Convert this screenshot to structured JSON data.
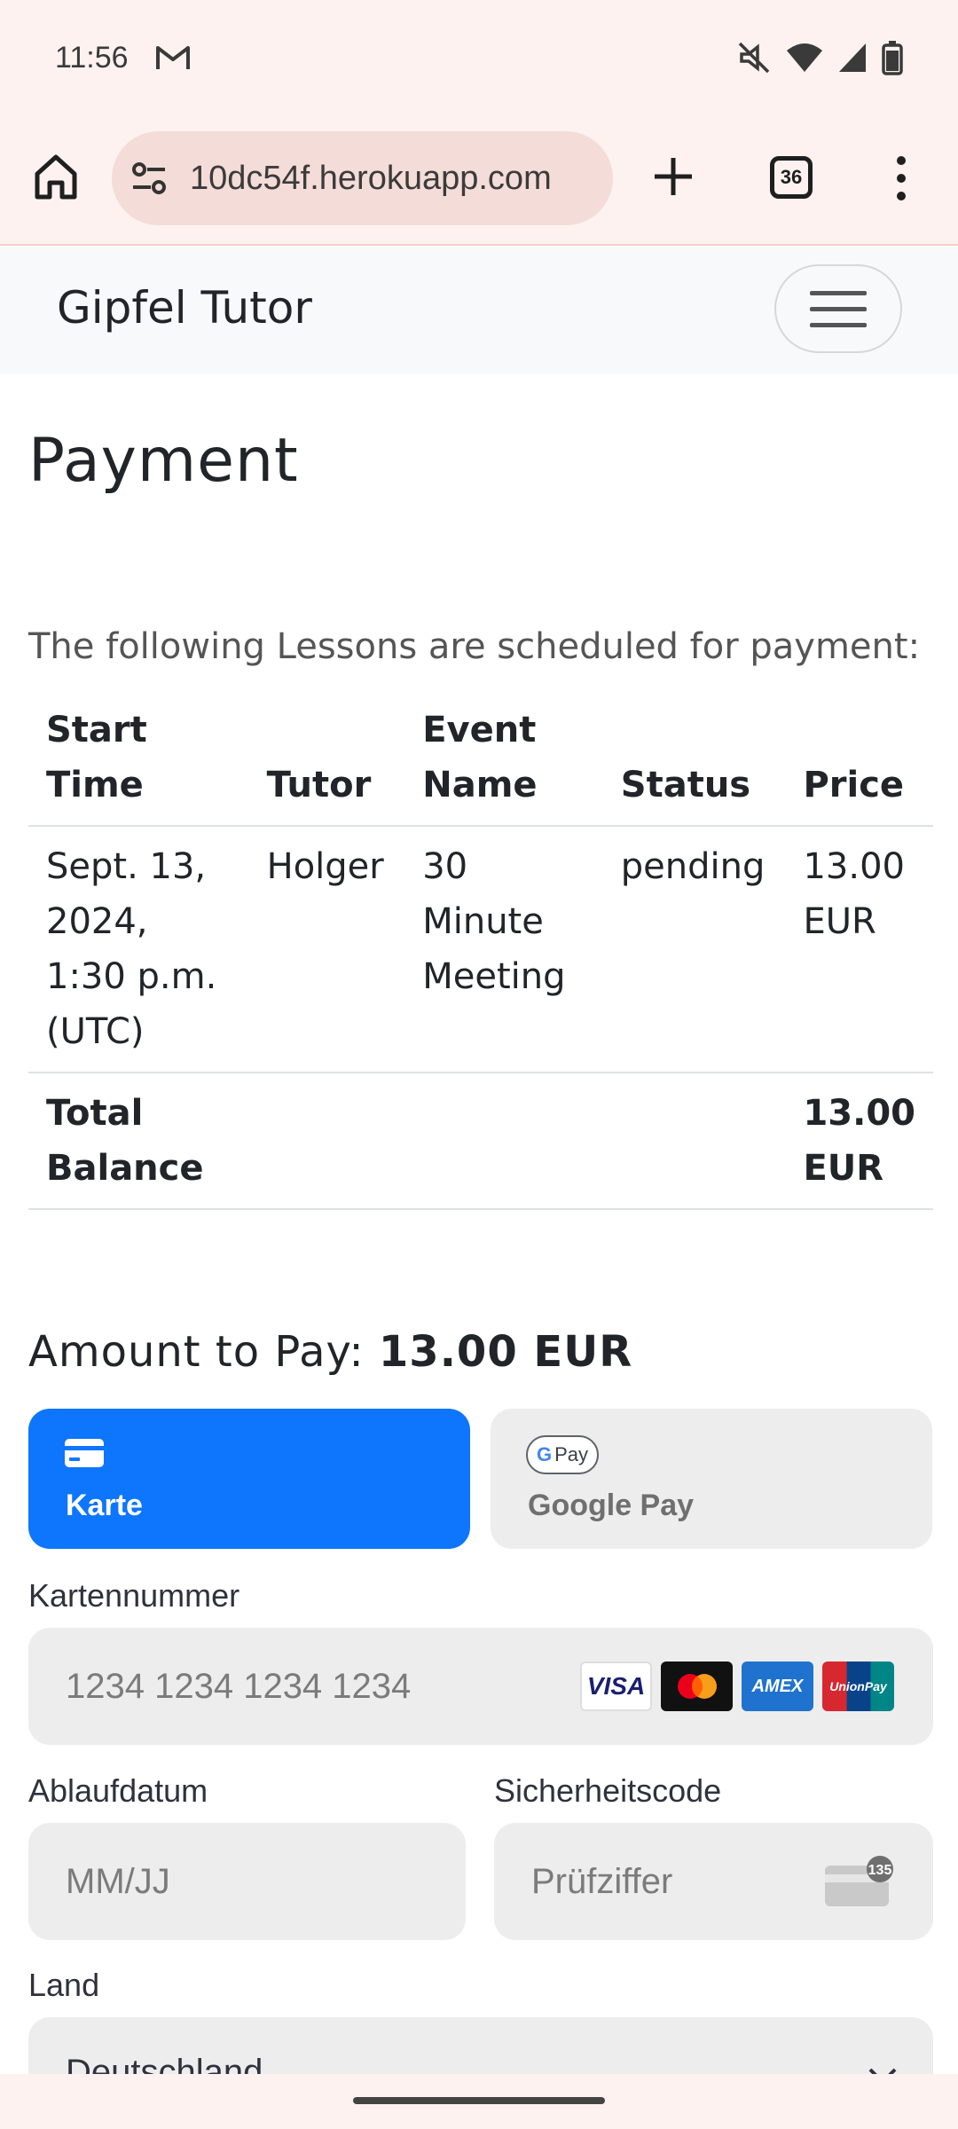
{
  "status_bar": {
    "time": "11:56",
    "icons": [
      "gmail-icon",
      "mute-icon",
      "wifi-icon",
      "signal-icon",
      "battery-icon"
    ]
  },
  "browser": {
    "url": "10dc54f.herokuapp.com",
    "tab_count": "36",
    "icons": [
      "home-icon",
      "site-settings-icon",
      "new-tab-icon",
      "tabs-icon",
      "more-menu-icon"
    ]
  },
  "navbar": {
    "brand": "Gipfel Tutor"
  },
  "page": {
    "title": "Payment",
    "intro": "The following Lessons are scheduled for payment:"
  },
  "lessons_table": {
    "headers": [
      "Start Time",
      "Tutor",
      "Event Name",
      "Status",
      "Price"
    ],
    "rows": [
      {
        "start_time": "Sept. 13, 2024, 1:30 p.m. (UTC)",
        "tutor": "Holger",
        "event_name": "30 Minute Meeting",
        "status": "pending",
        "price": "13.00 EUR"
      }
    ],
    "total_label": "Total Balance",
    "total_value": "13.00 EUR"
  },
  "amount": {
    "label": "Amount to Pay:",
    "value": "13.00 EUR"
  },
  "payment_methods": {
    "card_label": "Karte",
    "gpay_label": "Google Pay",
    "gpay_badge": "Pay",
    "selected": "Karte"
  },
  "form": {
    "card_number_label": "Kartennummer",
    "card_number_placeholder": "1234 1234 1234 1234",
    "expiry_label": "Ablaufdatum",
    "expiry_placeholder": "MM/JJ",
    "cvc_label": "Sicherheitscode",
    "cvc_placeholder": "Prüfziffer",
    "cvc_badge": "135",
    "country_label": "Land",
    "country_value": "Deutschland",
    "card_brands": [
      "VISA",
      "Mastercard",
      "AMEX",
      "UnionPay"
    ]
  },
  "colors": {
    "primary": "#0d76fc",
    "status_bar_bg": "#fdf2f0",
    "url_pill_bg": "#f4dcd8",
    "navbar_bg": "#f8f9fa",
    "field_bg": "#ededed"
  }
}
